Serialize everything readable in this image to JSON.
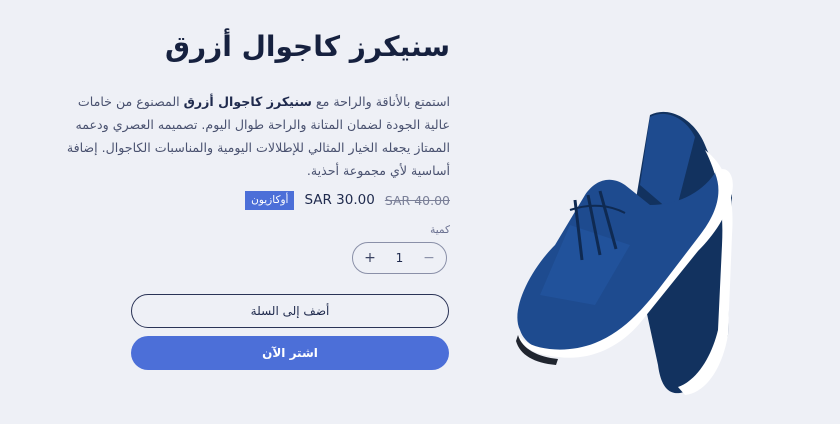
{
  "product": {
    "title": "سنيكرز كاجوال أزرق",
    "description": {
      "pre": "استمتع بالأناقة والراحة مع ",
      "name": "سنيكرز كاجوال أزرق",
      "post": " المصنوع من خامات عالية الجودة لضمان المتانة والراحة طوال اليوم. تصميمه العصري ودعمه الممتاز يجعله الخيار المثالي للإطلالات اليومية والمناسبات الكاجوال. إضافة أساسية لأي مجموعة أحذية."
    },
    "old_price": "SAR 40.00",
    "price": "SAR 30.00",
    "badge": "أوكازيون",
    "quantity_label": "كمية",
    "quantity": "1",
    "minus": "−",
    "plus": "+",
    "add_to_cart": "أضف إلى السلة",
    "buy_now": "اشتر الآن",
    "image_icon": "blue-sneaker-image"
  },
  "colors": {
    "background": "#eef0f6",
    "accent": "#4c6fd8",
    "shoe_main": "#1e4b8f",
    "shoe_dark": "#12325f",
    "sole": "#ffffff"
  }
}
